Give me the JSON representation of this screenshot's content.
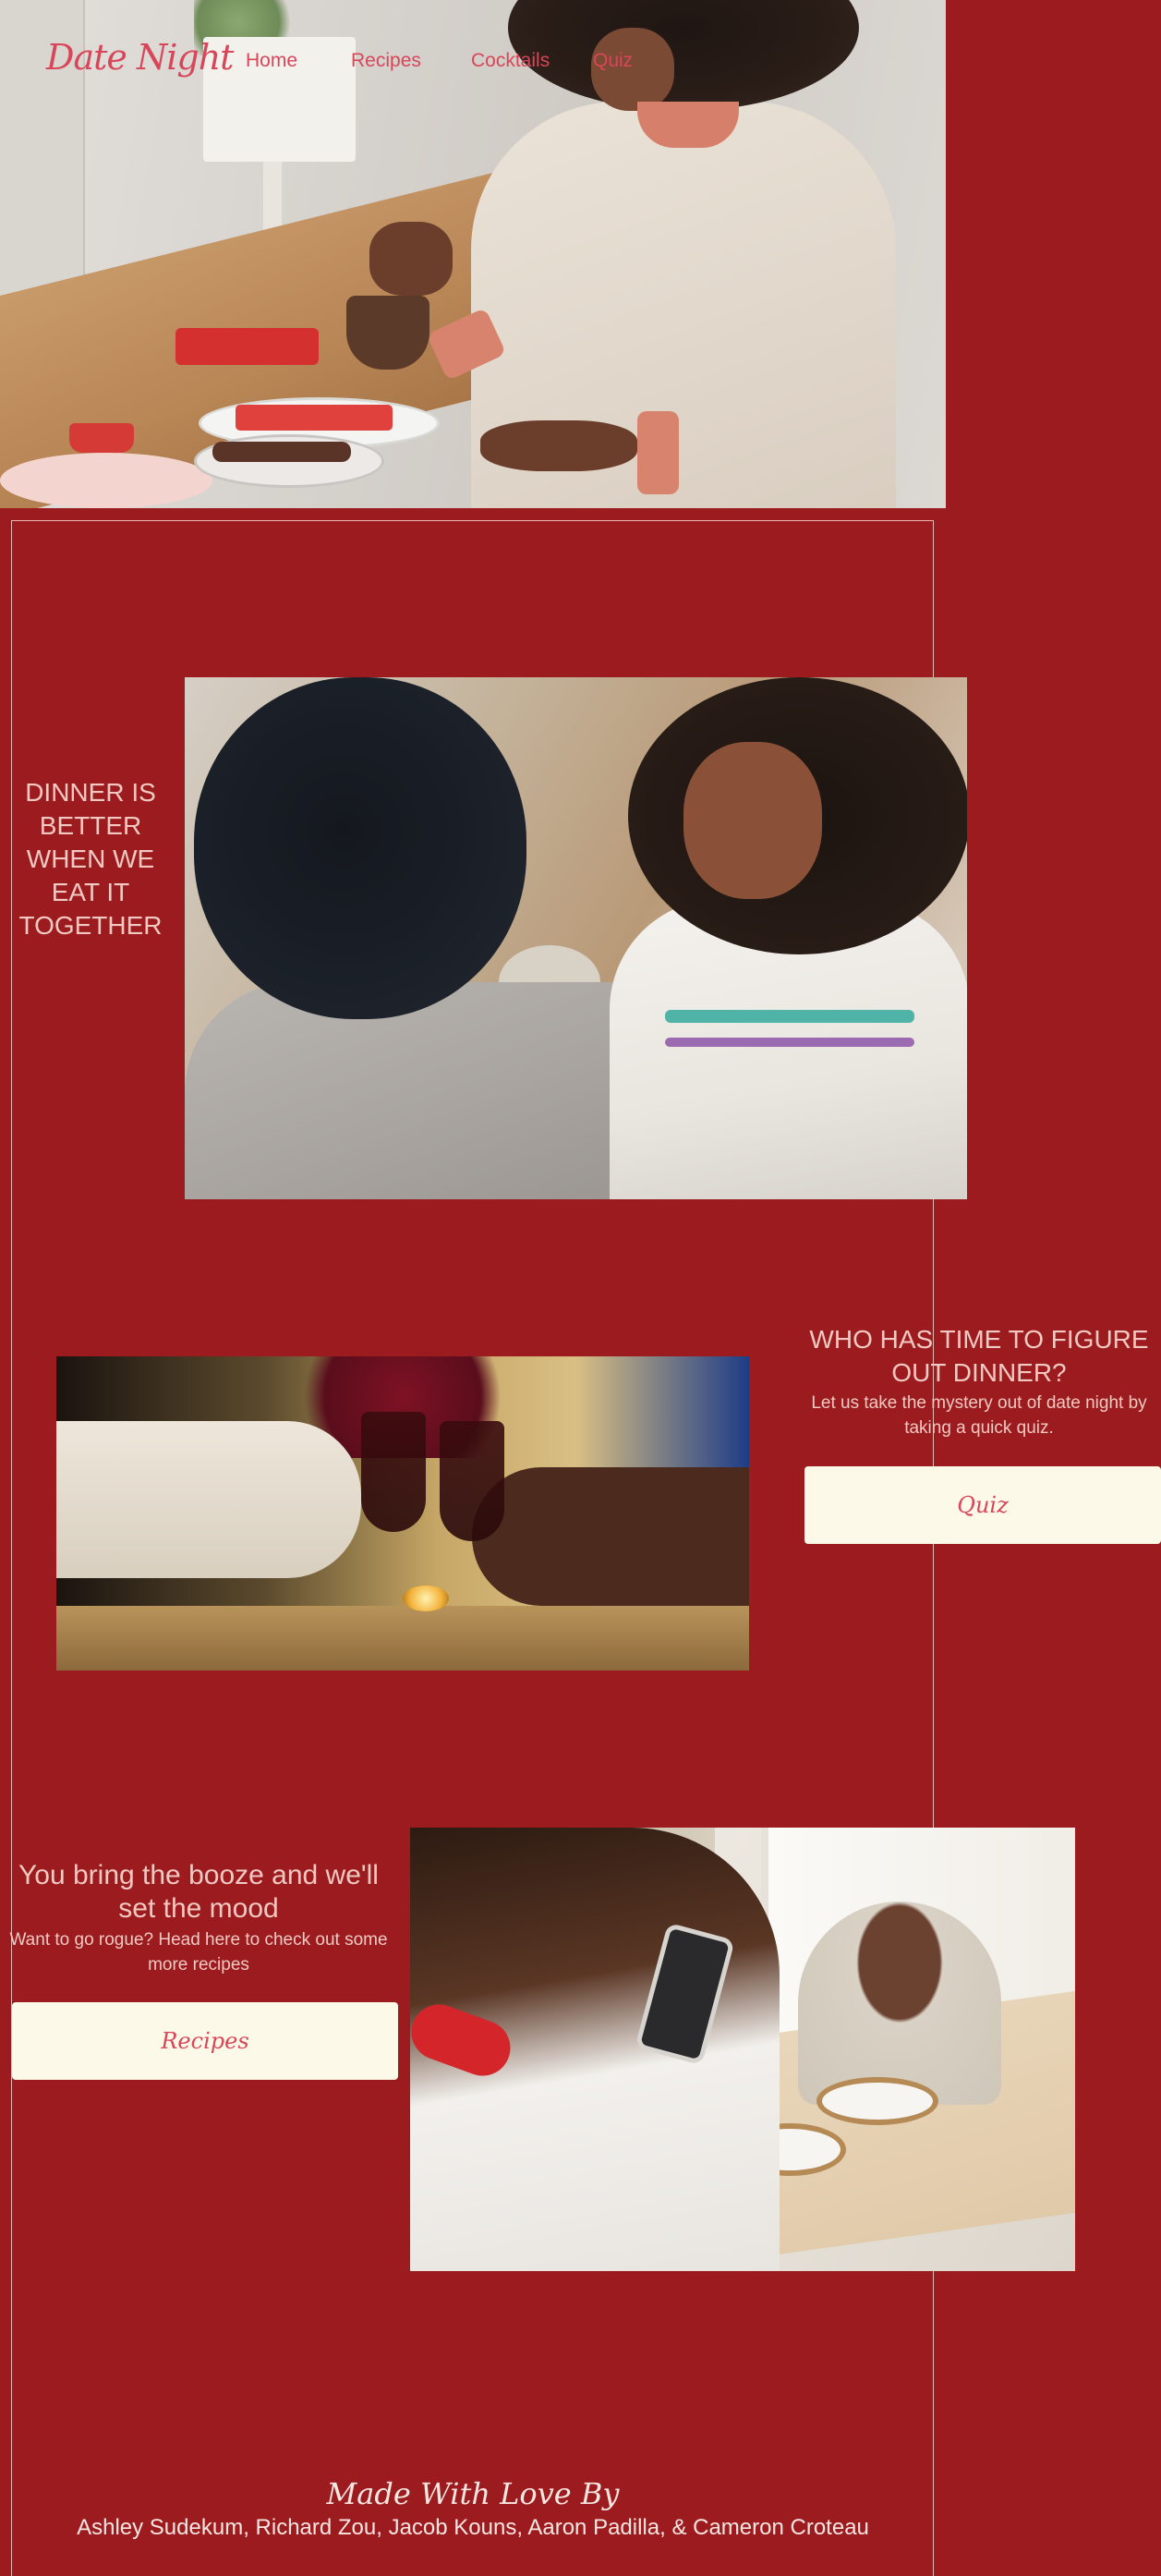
{
  "brand": {
    "logo": "Date Night"
  },
  "nav": {
    "items": [
      {
        "label": "Home"
      },
      {
        "label": "Recipes"
      },
      {
        "label": "Cocktails"
      },
      {
        "label": "Quiz"
      }
    ]
  },
  "sections": {
    "dinner": {
      "heading": "DINNER IS BETTER WHEN WE EAT IT TOGETHER"
    },
    "quiz": {
      "heading": "WHO HAS TIME TO FIGURE OUT DINNER?",
      "subtext": "Let us take the mystery out of date night by taking a quick quiz.",
      "button_label": "Quiz"
    },
    "booze": {
      "heading": "You bring the booze and we'll set the mood",
      "subtext": "Want to go rogue? Head here to check out some more recipes",
      "button_label": "Recipes"
    }
  },
  "footer": {
    "title": "Made With Love By",
    "names": "Ashley Sudekum, Richard Zou, Jacob Kouns, Aaron Padilla, & Cameron Croteau"
  },
  "colors": {
    "background": "#9b1b1e",
    "accent": "#d8465a",
    "button_bg": "#fdf9e8",
    "text_light": "#f2c8c2"
  }
}
